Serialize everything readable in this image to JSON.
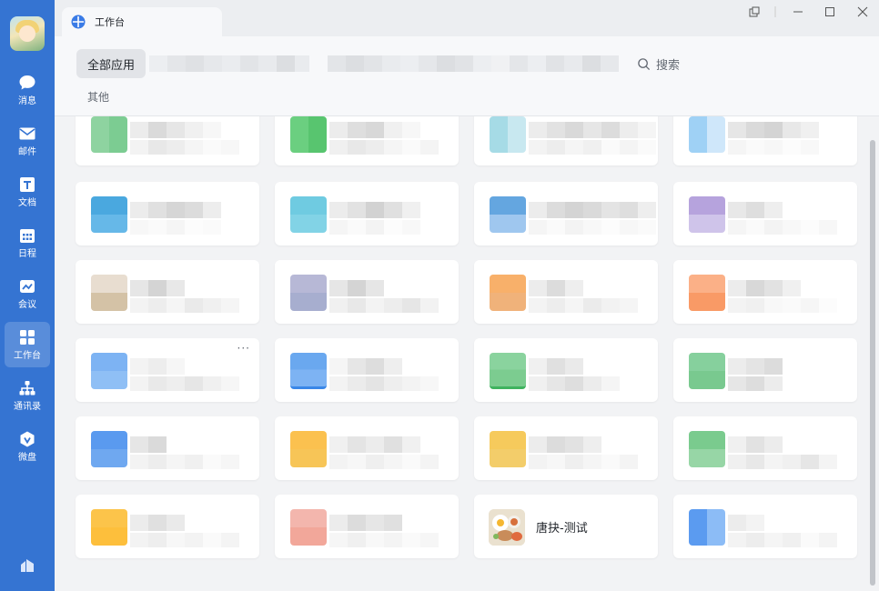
{
  "sidebar": {
    "items": [
      {
        "label": "消息",
        "icon": "message-icon"
      },
      {
        "label": "邮件",
        "icon": "mail-icon"
      },
      {
        "label": "文档",
        "icon": "document-icon"
      },
      {
        "label": "日程",
        "icon": "calendar-icon"
      },
      {
        "label": "会议",
        "icon": "meeting-icon"
      },
      {
        "label": "工作台",
        "icon": "workbench-icon",
        "active": true
      },
      {
        "label": "通讯录",
        "icon": "contacts-icon"
      },
      {
        "label": "微盘",
        "icon": "drive-icon"
      }
    ]
  },
  "tab": {
    "label": "工作台"
  },
  "header": {
    "active_filter": "全部应用",
    "search_label": "搜索",
    "section_label": "其他"
  },
  "apps": {
    "named": {
      "label": "唐抉-测试"
    },
    "more_label": "···"
  },
  "colors": {
    "sidebar": "#3574d2",
    "accent_blue": "#3a7be6"
  }
}
